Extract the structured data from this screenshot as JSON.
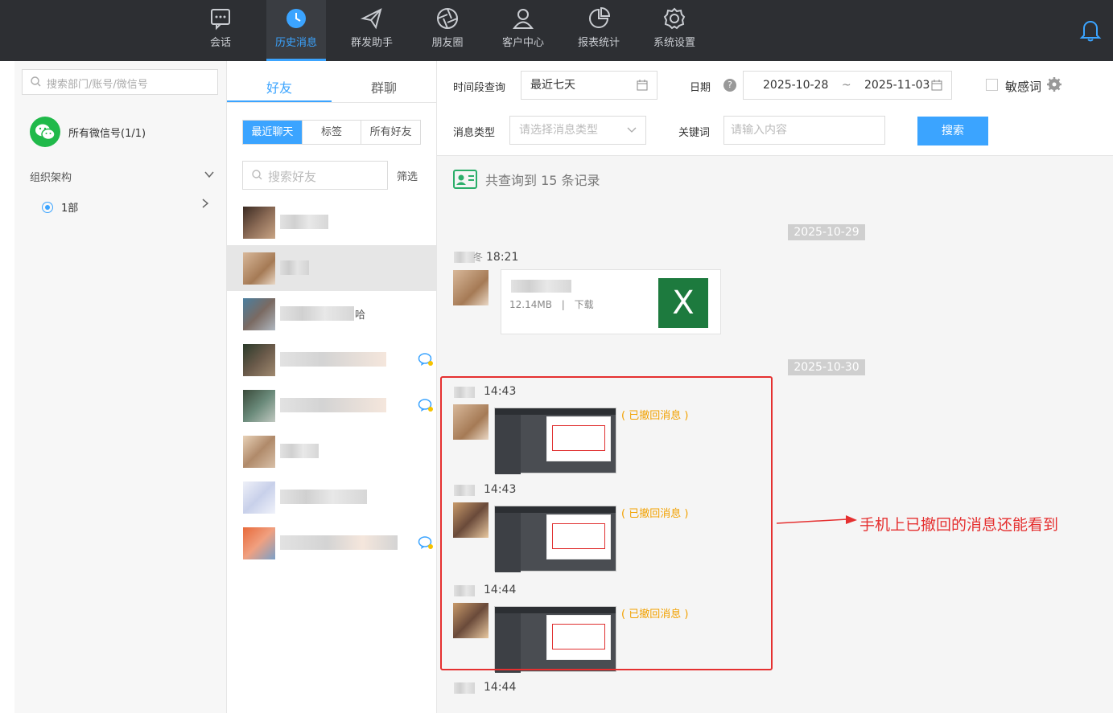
{
  "nav": {
    "items": [
      {
        "label": "会话",
        "icon": "chat-icon"
      },
      {
        "label": "历史消息",
        "icon": "clock-icon",
        "active": true
      },
      {
        "label": "群发助手",
        "icon": "send-icon"
      },
      {
        "label": "朋友圈",
        "icon": "aperture-icon"
      },
      {
        "label": "客户中心",
        "icon": "user-icon"
      },
      {
        "label": "报表统计",
        "icon": "pie-chart-icon"
      },
      {
        "label": "系统设置",
        "icon": "gear-icon"
      }
    ],
    "accent": "#3ba4ff"
  },
  "left": {
    "search_placeholder": "搜索部门/账号/微信号",
    "all_accounts": "所有微信号(1/1)",
    "org_label": "组织架构",
    "dept": "1部"
  },
  "mid": {
    "tabs": [
      "好友",
      "群聊"
    ],
    "segments": [
      "最近聊天",
      "标签",
      "所有好友"
    ],
    "search_placeholder": "搜索好友",
    "filter_label": "筛选",
    "friend_suffix": "哈"
  },
  "filters": {
    "period_label": "时间段查询",
    "period_value": "最近七天",
    "date_label": "日期",
    "help": "?",
    "date_from": "2025-10-28",
    "date_sep": "~",
    "date_to": "2025-11-03",
    "sensitive_label": "敏感词",
    "type_label": "消息类型",
    "type_placeholder": "请选择消息类型",
    "keyword_label": "关键词",
    "keyword_placeholder": "请输入内容",
    "search_button": "搜索"
  },
  "result_text": "共查询到 15 条记录",
  "messages": {
    "date1": "2025-10-29",
    "m1_name_tail": "冬",
    "m1_time": "18:21",
    "file_size": "12.14MB",
    "file_sep": "|",
    "file_download": "下载",
    "excel_letter": "X",
    "date2": "2025-10-30",
    "m2_time": "14:43",
    "m3_time": "14:43",
    "m4_time": "14:44",
    "m5_time": "14:44",
    "recalled": "( 已撤回消息 )",
    "annotation": "手机上已撤回的消息还能看到"
  }
}
